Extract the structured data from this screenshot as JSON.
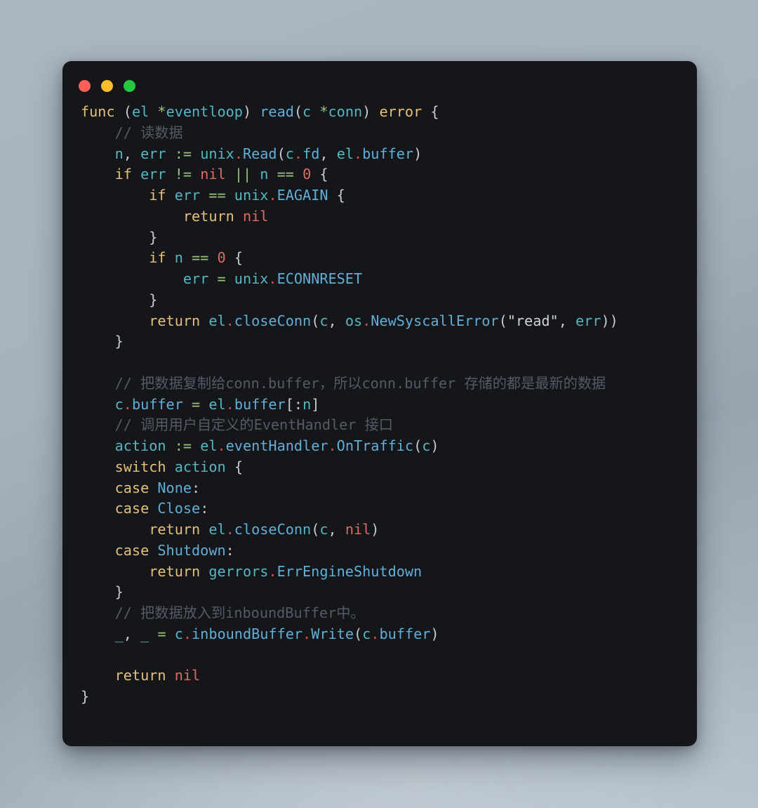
{
  "window": {
    "name": "code-snippet-window",
    "background_color": "#15161a",
    "desktop_color": "#a9b5c0",
    "traffic_lights": [
      {
        "name": "close-button",
        "label": "Close",
        "color": "#ff5f56"
      },
      {
        "name": "minimize-button",
        "label": "Minimize",
        "color": "#fdbc2c"
      },
      {
        "name": "maximize-button",
        "label": "Maximize",
        "color": "#25c83f"
      }
    ]
  },
  "editor": {
    "language": "go",
    "theme": {
      "keyword": "#e5c07b",
      "identifier": "#56b6c2",
      "function": "#61afd8",
      "operator": "#98c379",
      "literal": "#e06c5f",
      "string": "#cfd3d8",
      "punctuation": "#c8ccd2",
      "member_dot": "#d8504a",
      "comment": "#545b66",
      "background": "#15161a"
    },
    "lines": [
      "func (el *eventloop) read(c *conn) error {",
      "    // 读数据",
      "    n, err := unix.Read(c.fd, el.buffer)",
      "    if err != nil || n == 0 {",
      "        if err == unix.EAGAIN {",
      "            return nil",
      "        }",
      "        if n == 0 {",
      "            err = unix.ECONNRESET",
      "        }",
      "        return el.closeConn(c, os.NewSyscallError(\"read\", err))",
      "    }",
      "",
      "    // 把数据复制给conn.buffer，所以conn.buffer 存储的都是最新的数据",
      "    c.buffer = el.buffer[:n]",
      "    // 调用用户自定义的EventHandler 接口",
      "    action := el.eventHandler.OnTraffic(c)",
      "    switch action {",
      "    case None:",
      "    case Close:",
      "        return el.closeConn(c, nil)",
      "    case Shutdown:",
      "        return gerrors.ErrEngineShutdown",
      "    }",
      "    // 把数据放入到inboundBuffer中。",
      "    _, _ = c.inboundBuffer.Write(c.buffer)",
      "",
      "    return nil",
      "}"
    ],
    "tokens": {
      "keywords": [
        "func",
        "if",
        "return",
        "switch",
        "case",
        "error"
      ],
      "literals": [
        "nil",
        "0"
      ],
      "strings": [
        "\"read\""
      ],
      "comments": [
        "// 读数据",
        "// 把数据复制给conn.buffer，所以conn.buffer 存储的都是最新的数据",
        "// 调用用户自定义的EventHandler 接口",
        "// 把数据放入到inboundBuffer中。"
      ],
      "identifiers": [
        "el",
        "eventloop",
        "read",
        "c",
        "conn",
        "n",
        "err",
        "unix",
        "Read",
        "fd",
        "buffer",
        "EAGAIN",
        "ECONNRESET",
        "closeConn",
        "os",
        "NewSyscallError",
        "action",
        "eventHandler",
        "OnTraffic",
        "None",
        "Close",
        "Shutdown",
        "gerrors",
        "ErrEngineShutdown",
        "inboundBuffer",
        "Write"
      ]
    }
  }
}
